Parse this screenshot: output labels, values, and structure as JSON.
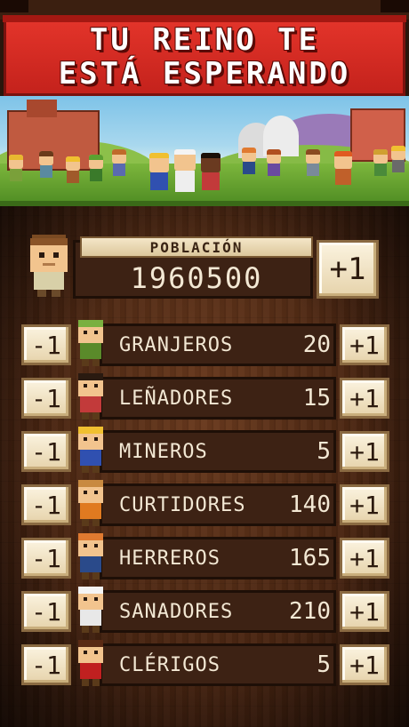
{
  "banner": {
    "line1": "TU REINO TE",
    "line2": "ESTÁ ESPERANDO"
  },
  "population": {
    "label": "POBLACIÓN",
    "value": "1960500",
    "plus_label": "+1"
  },
  "rows": [
    {
      "label": "GRANJEROS",
      "value": "20",
      "minus": "-1",
      "plus": "+1",
      "hair": "#7ab040",
      "shirt": "#5a8a2a"
    },
    {
      "label": "LEÑADORES",
      "value": "15",
      "minus": "-1",
      "plus": "+1",
      "hair": "#2a1a10",
      "shirt": "#c23a3a"
    },
    {
      "label": "MINEROS",
      "value": "5",
      "minus": "-1",
      "plus": "+1",
      "hair": "#f0c030",
      "shirt": "#3050b0"
    },
    {
      "label": "CURTIDORES",
      "value": "140",
      "minus": "-1",
      "plus": "+1",
      "hair": "#c88a40",
      "shirt": "#e07a20"
    },
    {
      "label": "HERREROS",
      "value": "165",
      "minus": "-1",
      "plus": "+1",
      "hair": "#e07a30",
      "shirt": "#2a4a8a"
    },
    {
      "label": "SANADORES",
      "value": "210",
      "minus": "-1",
      "plus": "+1",
      "hair": "#f4f4f4",
      "shirt": "#e8e8e8"
    },
    {
      "label": "CLÉRIGOS",
      "value": "5",
      "minus": "-1",
      "plus": "+1",
      "hair": "#5a2a14",
      "shirt": "#c02020"
    }
  ]
}
